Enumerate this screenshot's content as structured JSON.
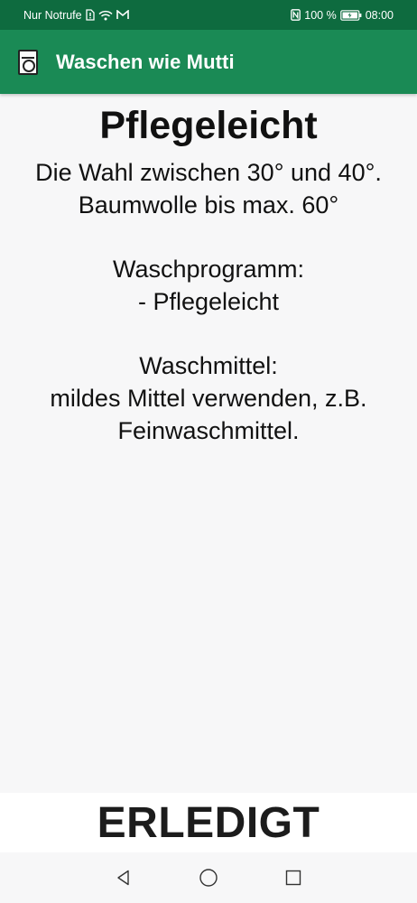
{
  "status_bar": {
    "carrier": "Nur Notrufe",
    "battery_percent": "100 %",
    "time": "08:00",
    "icons": [
      "sim-alert-icon",
      "wifi-icon",
      "mail-icon",
      "nfc-icon",
      "battery-icon"
    ]
  },
  "app_bar": {
    "title": "Waschen wie Mutti",
    "icon": "washing-machine-icon",
    "background": "#1a8a55",
    "status_background": "#0e6b3f"
  },
  "program": {
    "title": "Pflegeleicht",
    "temperature_line1": "Die Wahl zwischen 30° und 40°.",
    "temperature_line2": "Baumwolle bis max. 60°",
    "program_label": "Waschprogramm:",
    "program_value": "- Pflegeleicht",
    "detergent_label": "Waschmittel:",
    "detergent_line1": "mildes Mittel verwenden, z.B.",
    "detergent_line2": "Feinwaschmittel."
  },
  "actions": {
    "done_label": "ERLEDIGT"
  },
  "navigation": {
    "icons": [
      "back-icon",
      "home-icon",
      "recents-icon"
    ]
  }
}
